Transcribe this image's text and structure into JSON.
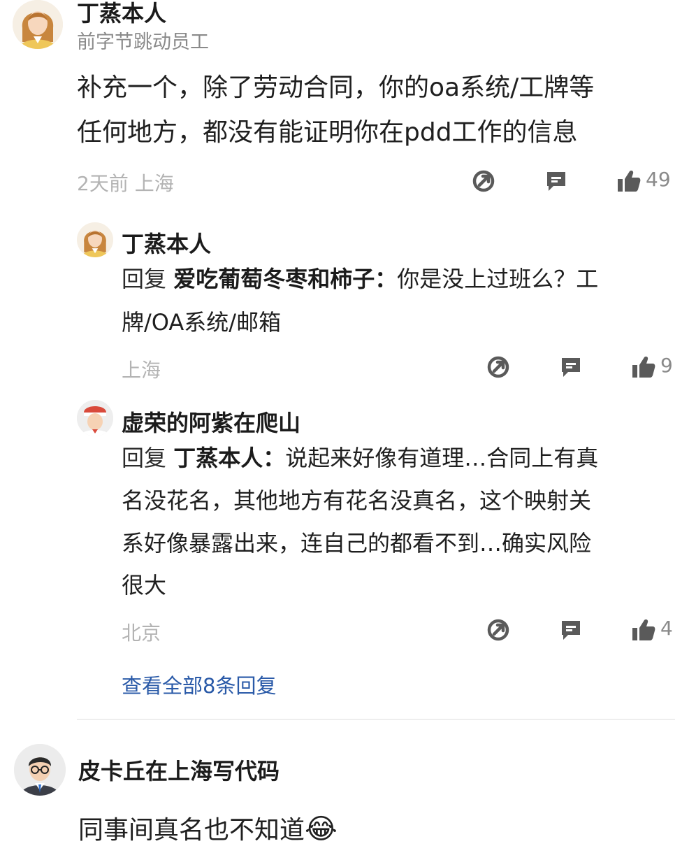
{
  "comment1": {
    "author": "丁蒸本人",
    "subtitle": "前字节跳动员工",
    "text_line1": "补充一个，除了劳动合同，你的oa系统/工牌等",
    "text_line2": "任何地方，都没有能证明你在pdd工作的信息",
    "time_location": "2天前  上海",
    "like_count": "49"
  },
  "reply1": {
    "author": "丁蒸本人",
    "reply_prefix": "回复 ",
    "reply_target": "爱吃葡萄冬枣和柿子：",
    "text_line1_rest": "你是没上过班么？工",
    "text_line2": "牌/OA系统/邮箱",
    "location": "上海",
    "like_count": "9"
  },
  "reply2": {
    "author": "虚荣的阿紫在爬山",
    "reply_prefix": "回复 ",
    "reply_target": "丁蒸本人：",
    "text_line1_rest": "说起来好像有道理…合同上有真",
    "text_line2": "名没花名，其他地方有花名没真名，这个映射关",
    "text_line3": "系好像暴露出来，连自己的都看不到…确实风险",
    "text_line4": "很大",
    "location": "北京",
    "like_count": "4"
  },
  "view_all_replies": "查看全部8条回复",
  "comment2": {
    "author": "皮卡丘在上海写代码",
    "text": "同事间真名也不知道",
    "emoji": "😂"
  },
  "icons": {
    "share": "share-icon",
    "comment": "comment-icon",
    "like": "thumbs-up-icon"
  },
  "colors": {
    "link": "#2a5aa8",
    "meta": "#b3b3b3",
    "icon": "#5a5a5a"
  }
}
